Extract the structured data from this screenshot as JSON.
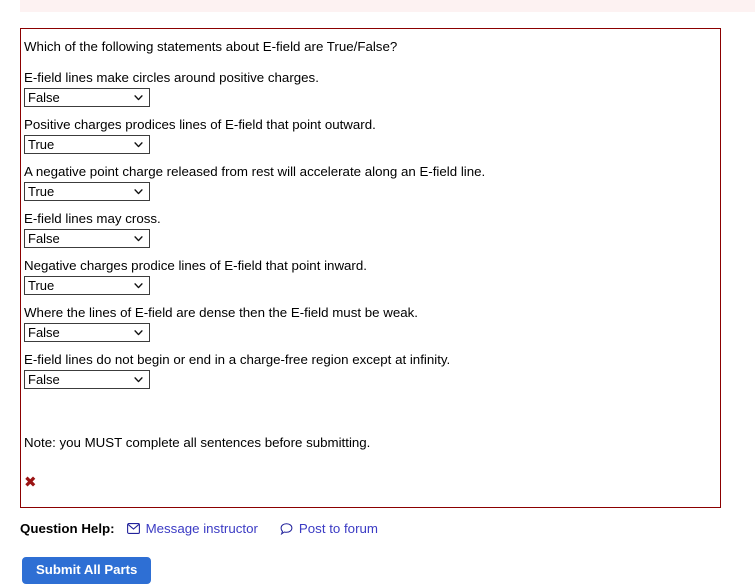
{
  "page": {
    "top_strip_color": "#fdf2f2",
    "panel_border_color": "#8b0000",
    "link_color": "#3b3bc4",
    "button_color": "#2e6fd4",
    "error_color": "#9b1313"
  },
  "question": {
    "prompt": "Which of the following statements about E-field are True/False?",
    "note": "Note: you MUST complete all sentences before submitting.",
    "result_mark": "✖",
    "statements": [
      {
        "text": "E-field lines make circles around positive charges.",
        "selected": "False",
        "options": [
          "",
          "True",
          "False"
        ]
      },
      {
        "text": "Positive charges prodices lines of E-field that point outward.",
        "selected": "True",
        "options": [
          "",
          "True",
          "False"
        ]
      },
      {
        "text": "A negative point charge released from rest will accelerate along an E-field line.",
        "selected": "True",
        "options": [
          "",
          "True",
          "False"
        ]
      },
      {
        "text": "E-field lines may cross.",
        "selected": "False",
        "options": [
          "",
          "True",
          "False"
        ]
      },
      {
        "text": "Negative charges prodice lines of E-field that point inward.",
        "selected": "True",
        "options": [
          "",
          "True",
          "False"
        ]
      },
      {
        "text": "Where the lines of E-field are dense then the E-field must be weak.",
        "selected": "False",
        "options": [
          "",
          "True",
          "False"
        ]
      },
      {
        "text": "E-field lines do not begin or end in a charge-free region except at infinity.",
        "selected": "False",
        "options": [
          "",
          "True",
          "False"
        ]
      }
    ]
  },
  "help": {
    "label": "Question Help:",
    "message_instructor": "Message instructor",
    "post_to_forum": "Post to forum"
  },
  "actions": {
    "submit_label": "Submit All Parts"
  }
}
